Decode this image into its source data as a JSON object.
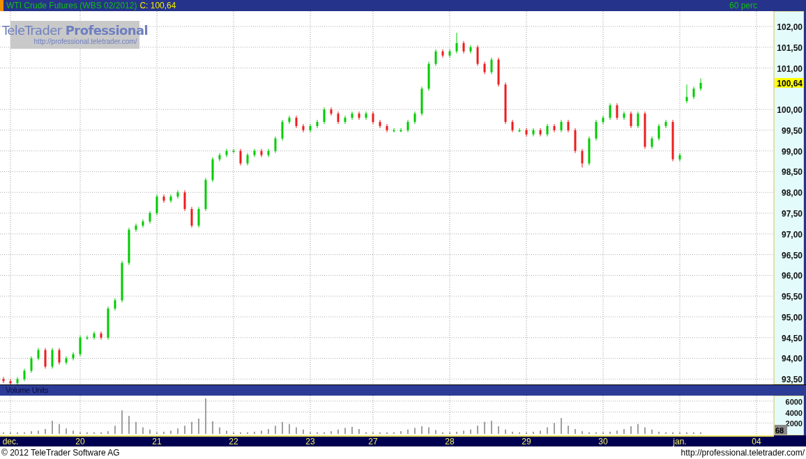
{
  "title_bar": {
    "instrument": "WTI Crude Futures (WBS 02/2012)",
    "close_label": "C: 100,64",
    "interval": "60 perc"
  },
  "logo": {
    "name": "TeleTrader **Professional**",
    "url": "http://professional.teletrader.com/"
  },
  "price_panel": {
    "last_price": "100,64",
    "chart_data": {
      "type": "candlestick",
      "grid": true,
      "ylim": [
        93.37,
        102.37
      ],
      "categories": [
        null,
        "dec.",
        null,
        null,
        null,
        null,
        null,
        null,
        null,
        null,
        null,
        "20",
        null,
        null,
        null,
        null,
        null,
        null,
        null,
        null,
        null,
        null,
        "21",
        null,
        null,
        null,
        null,
        null,
        null,
        null,
        null,
        null,
        null,
        "22",
        null,
        null,
        null,
        null,
        null,
        null,
        null,
        null,
        null,
        null,
        "23",
        null,
        null,
        null,
        null,
        null,
        null,
        null,
        null,
        "27",
        null,
        null,
        null,
        null,
        null,
        null,
        null,
        null,
        null,
        null,
        "28",
        null,
        null,
        null,
        null,
        null,
        null,
        null,
        null,
        null,
        null,
        "29",
        null,
        null,
        null,
        null,
        null,
        null,
        null,
        null,
        null,
        null,
        "30",
        null,
        null,
        null,
        null,
        null,
        null,
        null,
        null,
        null,
        null,
        "jan.",
        null,
        null,
        null,
        null,
        null,
        null,
        null,
        null,
        null,
        null,
        "04",
        null,
        null
      ],
      "ohlc": [
        [
          93.5,
          93.55,
          93.4,
          93.45
        ],
        [
          93.45,
          93.5,
          93.35,
          93.4
        ],
        [
          93.4,
          93.55,
          93.35,
          93.5
        ],
        [
          93.5,
          93.75,
          93.45,
          93.7
        ],
        [
          93.7,
          94.05,
          93.65,
          94.0
        ],
        [
          94.0,
          94.25,
          93.95,
          94.2
        ],
        [
          94.2,
          94.25,
          93.75,
          93.8
        ],
        [
          93.8,
          94.25,
          93.75,
          94.2
        ],
        [
          94.2,
          94.25,
          93.85,
          93.9
        ],
        [
          93.9,
          94.05,
          93.85,
          94.0
        ],
        [
          94.0,
          94.15,
          93.95,
          94.1
        ],
        [
          94.1,
          94.55,
          94.05,
          94.5
        ],
        [
          94.5,
          94.55,
          94.45,
          94.5
        ],
        [
          94.5,
          94.65,
          94.45,
          94.6
        ],
        [
          94.6,
          94.65,
          94.45,
          94.5
        ],
        [
          94.5,
          95.25,
          94.45,
          95.2
        ],
        [
          95.2,
          95.45,
          95.15,
          95.4
        ],
        [
          95.4,
          96.35,
          95.35,
          96.3
        ],
        [
          96.3,
          97.15,
          96.25,
          97.1
        ],
        [
          97.1,
          97.25,
          97.05,
          97.2
        ],
        [
          97.2,
          97.35,
          97.15,
          97.3
        ],
        [
          97.3,
          97.55,
          97.25,
          97.5
        ],
        [
          97.5,
          97.95,
          97.45,
          97.9
        ],
        [
          97.9,
          97.95,
          97.75,
          97.8
        ],
        [
          97.8,
          97.95,
          97.75,
          97.9
        ],
        [
          97.9,
          98.05,
          97.85,
          98.0
        ],
        [
          98.0,
          98.05,
          97.55,
          97.6
        ],
        [
          97.6,
          97.65,
          97.15,
          97.2
        ],
        [
          97.2,
          97.65,
          97.15,
          97.6
        ],
        [
          97.6,
          98.35,
          97.55,
          98.3
        ],
        [
          98.3,
          98.85,
          98.25,
          98.8
        ],
        [
          98.8,
          98.95,
          98.75,
          98.9
        ],
        [
          98.9,
          99.05,
          98.85,
          99.0
        ],
        [
          99.0,
          99.05,
          98.95,
          99.0
        ],
        [
          99.0,
          99.05,
          98.65,
          98.7
        ],
        [
          98.7,
          98.95,
          98.65,
          98.9
        ],
        [
          98.9,
          99.05,
          98.85,
          99.0
        ],
        [
          99.0,
          99.05,
          98.85,
          98.9
        ],
        [
          98.9,
          99.05,
          98.85,
          99.0
        ],
        [
          99.0,
          99.35,
          98.95,
          99.3
        ],
        [
          99.3,
          99.75,
          99.25,
          99.7
        ],
        [
          99.7,
          99.85,
          99.65,
          99.8
        ],
        [
          99.8,
          99.85,
          99.55,
          99.6
        ],
        [
          99.6,
          99.65,
          99.45,
          99.5
        ],
        [
          99.5,
          99.65,
          99.45,
          99.6
        ],
        [
          99.6,
          99.75,
          99.55,
          99.7
        ],
        [
          99.7,
          100.05,
          99.65,
          100.0
        ],
        [
          100.0,
          100.05,
          99.85,
          99.9
        ],
        [
          99.9,
          99.95,
          99.65,
          99.7
        ],
        [
          99.7,
          99.85,
          99.65,
          99.8
        ],
        [
          99.8,
          99.95,
          99.75,
          99.9
        ],
        [
          99.9,
          99.95,
          99.75,
          99.8
        ],
        [
          99.8,
          99.95,
          99.75,
          99.9
        ],
        [
          99.9,
          99.95,
          99.65,
          99.7
        ],
        [
          99.7,
          99.75,
          99.55,
          99.6
        ],
        [
          99.6,
          99.65,
          99.45,
          99.5
        ],
        [
          99.5,
          99.55,
          99.45,
          99.5
        ],
        [
          99.5,
          99.55,
          99.45,
          99.5
        ],
        [
          99.5,
          99.75,
          99.45,
          99.7
        ],
        [
          99.7,
          99.95,
          99.65,
          99.9
        ],
        [
          99.9,
          100.55,
          99.85,
          100.5
        ],
        [
          100.5,
          101.15,
          100.45,
          101.1
        ],
        [
          101.1,
          101.45,
          101.05,
          101.4
        ],
        [
          101.4,
          101.45,
          101.25,
          101.3
        ],
        [
          101.3,
          101.45,
          101.25,
          101.4
        ],
        [
          101.4,
          101.85,
          101.35,
          101.6
        ],
        [
          101.6,
          101.65,
          101.35,
          101.4
        ],
        [
          101.4,
          101.55,
          101.35,
          101.5
        ],
        [
          101.5,
          101.55,
          101.05,
          101.1
        ],
        [
          101.1,
          101.15,
          100.85,
          100.9
        ],
        [
          100.9,
          101.25,
          100.85,
          101.2
        ],
        [
          101.2,
          101.25,
          100.55,
          100.6
        ],
        [
          100.6,
          100.65,
          99.65,
          99.7
        ],
        [
          99.7,
          99.75,
          99.45,
          99.5
        ],
        [
          99.5,
          99.55,
          99.45,
          99.5
        ],
        [
          99.5,
          99.55,
          99.35,
          99.4
        ],
        [
          99.4,
          99.55,
          99.35,
          99.5
        ],
        [
          99.5,
          99.55,
          99.35,
          99.4
        ],
        [
          99.4,
          99.65,
          99.35,
          99.6
        ],
        [
          99.6,
          99.65,
          99.45,
          99.5
        ],
        [
          99.5,
          99.75,
          99.45,
          99.7
        ],
        [
          99.7,
          99.75,
          99.45,
          99.5
        ],
        [
          99.5,
          99.55,
          98.95,
          99.0
        ],
        [
          99.0,
          99.05,
          98.6,
          98.7
        ],
        [
          98.7,
          99.35,
          98.65,
          99.3
        ],
        [
          99.3,
          99.75,
          99.25,
          99.7
        ],
        [
          99.7,
          99.85,
          99.65,
          99.8
        ],
        [
          99.8,
          100.15,
          99.75,
          100.1
        ],
        [
          100.1,
          100.15,
          99.75,
          99.8
        ],
        [
          99.8,
          99.95,
          99.75,
          99.9
        ],
        [
          99.9,
          99.95,
          99.55,
          99.6
        ],
        [
          99.6,
          99.95,
          99.55,
          99.9
        ],
        [
          99.9,
          99.95,
          99.05,
          99.1
        ],
        [
          99.1,
          99.35,
          99.05,
          99.3
        ],
        [
          99.3,
          99.65,
          99.25,
          99.6
        ],
        [
          99.6,
          99.75,
          99.55,
          99.7
        ],
        [
          99.7,
          99.75,
          98.75,
          98.8
        ],
        [
          98.8,
          98.95,
          98.75,
          98.9
        ],
        [
          100.2,
          100.6,
          100.15,
          100.3
        ],
        [
          100.3,
          100.55,
          100.25,
          100.5
        ],
        [
          100.5,
          100.75,
          100.45,
          100.64
        ],
        null,
        null,
        null,
        null,
        null,
        null,
        null,
        null,
        null,
        null
      ],
      "yticks": [
        {
          "value": 93.5,
          "label": "93,50"
        },
        {
          "value": 94,
          "label": "94,00"
        },
        {
          "value": 94.5,
          "label": "94,50"
        },
        {
          "value": 95,
          "label": "95,00"
        },
        {
          "value": 95.5,
          "label": "95,50"
        },
        {
          "value": 96,
          "label": "96,00"
        },
        {
          "value": 96.5,
          "label": "96,50"
        },
        {
          "value": 97,
          "label": "97,00"
        },
        {
          "value": 97.5,
          "label": "97,50"
        },
        {
          "value": 98,
          "label": "98,00"
        },
        {
          "value": 98.5,
          "label": "98,50"
        },
        {
          "value": 99,
          "label": "99,00"
        },
        {
          "value": 99.5,
          "label": "99,50"
        },
        {
          "value": 100,
          "label": "100,00"
        },
        {
          "value": 101,
          "label": "101,00"
        },
        {
          "value": 101.5,
          "label": "101,50"
        },
        {
          "value": 102,
          "label": "102,00"
        }
      ]
    }
  },
  "volume_panel": {
    "title": "Volume Units",
    "last_volume": "68",
    "chart_data": {
      "type": "bar",
      "grid": true,
      "ylim": [
        0,
        7000
      ],
      "categories": [
        null,
        null,
        null,
        null,
        null,
        null,
        null,
        null,
        null,
        null,
        null,
        null,
        null,
        null,
        null,
        null,
        null,
        null,
        null,
        null,
        null,
        null,
        null,
        null,
        null,
        null,
        null,
        null,
        null,
        null,
        null,
        null,
        null,
        null,
        null,
        null,
        null,
        null,
        null,
        null,
        null,
        null,
        null,
        null,
        null,
        null,
        null,
        null,
        null,
        null,
        null,
        null,
        null,
        null,
        null,
        null,
        null,
        null,
        null,
        null,
        null,
        null,
        null,
        null,
        null,
        null,
        null,
        null,
        null,
        null,
        null,
        null,
        null,
        null,
        null,
        null,
        null,
        null,
        null,
        null,
        null,
        null,
        null,
        null,
        null,
        null,
        null,
        null,
        null,
        null,
        null,
        null,
        null,
        null,
        null,
        null,
        null,
        null,
        null,
        null,
        null,
        null,
        null,
        null,
        null,
        null,
        null,
        null,
        null,
        null,
        null
      ],
      "values": [
        300,
        300,
        300,
        300,
        500,
        600,
        900,
        2400,
        1800,
        1000,
        600,
        300,
        300,
        300,
        300,
        500,
        1500,
        4300,
        3300,
        2200,
        1200,
        800,
        300,
        400,
        600,
        1000,
        1500,
        2200,
        2800,
        6500,
        2300,
        1200,
        600,
        300,
        300,
        300,
        400,
        600,
        900,
        1500,
        2200,
        1800,
        1200,
        800,
        300,
        300,
        300,
        500,
        800,
        1100,
        1300,
        900,
        300,
        300,
        300,
        300,
        300,
        500,
        800,
        1100,
        1400,
        1200,
        700,
        300,
        300,
        400,
        600,
        800,
        1500,
        2200,
        2400,
        1400,
        800,
        400,
        300,
        300,
        400,
        600,
        1200,
        2000,
        2900,
        1500,
        900,
        500,
        300,
        300,
        300,
        400,
        600,
        900,
        1400,
        1800,
        1200,
        800,
        400,
        300,
        300,
        300,
        300,
        300,
        300,
        null,
        null,
        null,
        null,
        null,
        null,
        null,
        null,
        null,
        null
      ],
      "yticks": [
        2000,
        4000,
        6000
      ]
    }
  },
  "footer": {
    "copyright": "© 2012 TeleTrader Software AG",
    "url": "http://professional.teletrader.com/"
  }
}
